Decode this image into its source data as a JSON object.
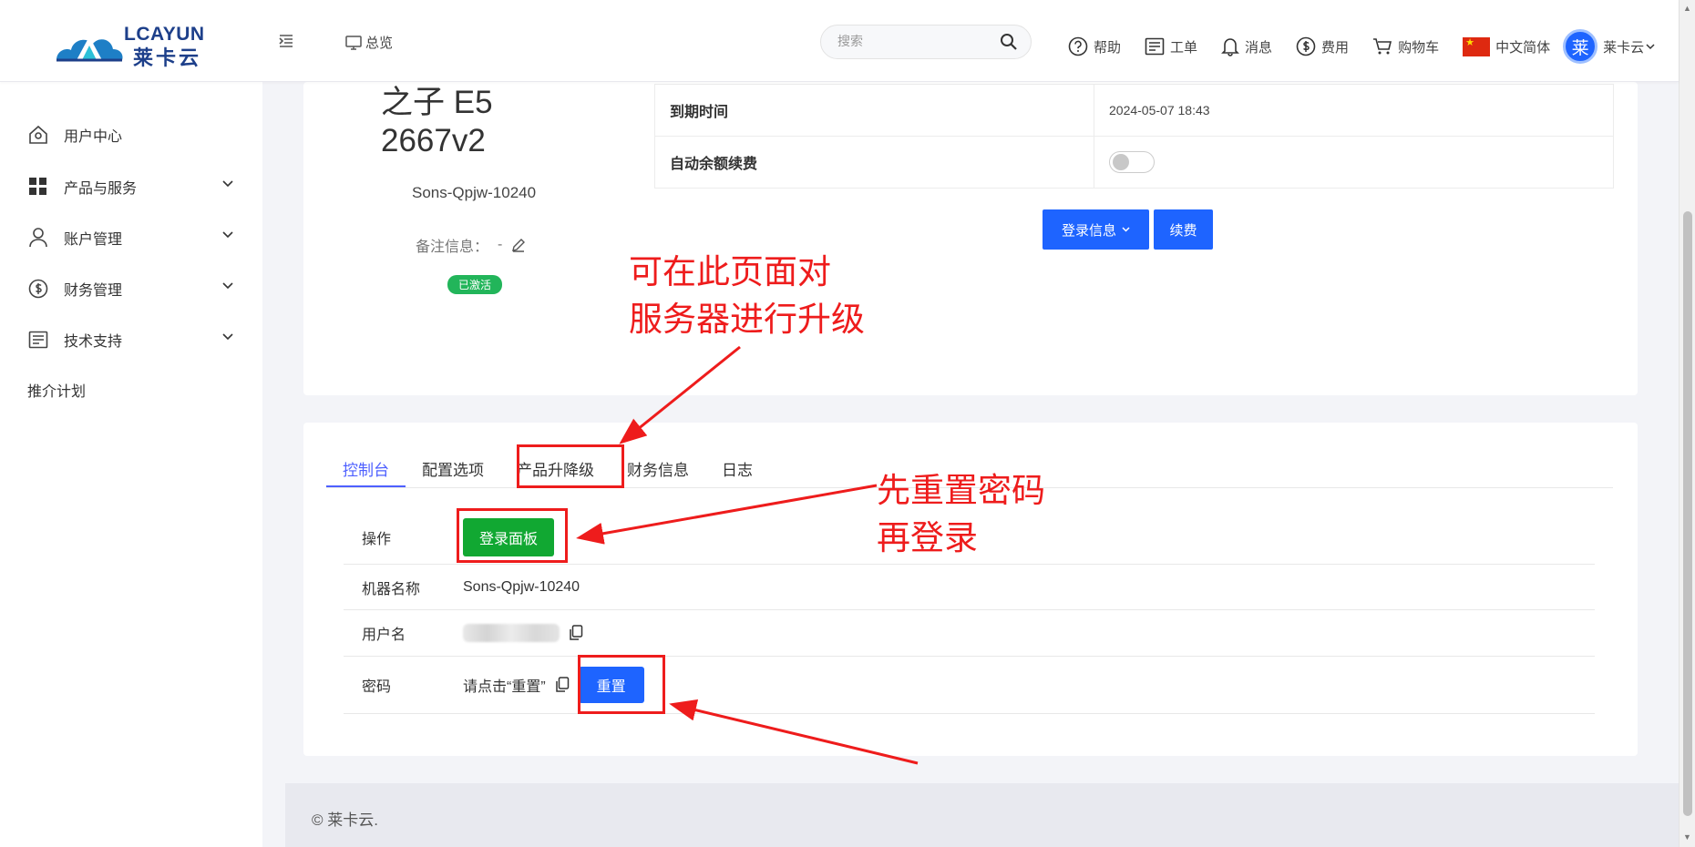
{
  "header": {
    "logo_text": "LCAYUN",
    "logo_subtext": "莱卡云",
    "overview_label": "总览",
    "search_placeholder": "搜索",
    "nav": {
      "help": "帮助",
      "ticket": "工单",
      "messages": "消息",
      "billing": "费用",
      "cart": "购物车",
      "language": "中文简体",
      "avatar_char": "莱",
      "username": "莱卡云"
    }
  },
  "sidebar": {
    "items": [
      {
        "label": "用户中心",
        "icon": "home-icon"
      },
      {
        "label": "产品与服务",
        "icon": "grid-icon"
      },
      {
        "label": "账户管理",
        "icon": "user-icon"
      },
      {
        "label": "财务管理",
        "icon": "dollar-icon"
      },
      {
        "label": "技术支持",
        "icon": "document-icon"
      },
      {
        "label": "推介计划",
        "icon": ""
      }
    ]
  },
  "product": {
    "name_line1": "之子 E5",
    "name_line2": "2667v2",
    "host_id": "Sons-Qpjw-10240",
    "remark_label": "备注信息：",
    "remark_value": "-",
    "status": "已激活"
  },
  "info": {
    "expire_label": "到期时间",
    "expire_value": "2024-05-07 18:43",
    "auto_renew_label": "自动余额续费",
    "auto_renew_on": false,
    "login_info_btn": "登录信息",
    "renew_btn": "续费"
  },
  "tabs": [
    "控制台",
    "配置选项",
    "产品升降级",
    "财务信息",
    "日志"
  ],
  "console": {
    "op_label": "操作",
    "panel_btn": "登录面板",
    "machine_label": "机器名称",
    "machine_value": "Sons-Qpjw-10240",
    "user_label": "用户名",
    "password_label": "密码",
    "password_hint": "请点击“重置”",
    "reset_btn": "重置"
  },
  "annotations": {
    "upgrade_note_1": "可在此页面对",
    "upgrade_note_2": "服务器进行升级",
    "reset_note_1": "先重置密码",
    "reset_note_2": "再登录",
    "color": "#ee1c1c"
  },
  "footer": {
    "copyright": "© 莱卡云."
  },
  "colors": {
    "primary": "#1e64ff",
    "tab_active": "#4e60ff",
    "success": "#11a832",
    "badge": "#22b55a"
  }
}
